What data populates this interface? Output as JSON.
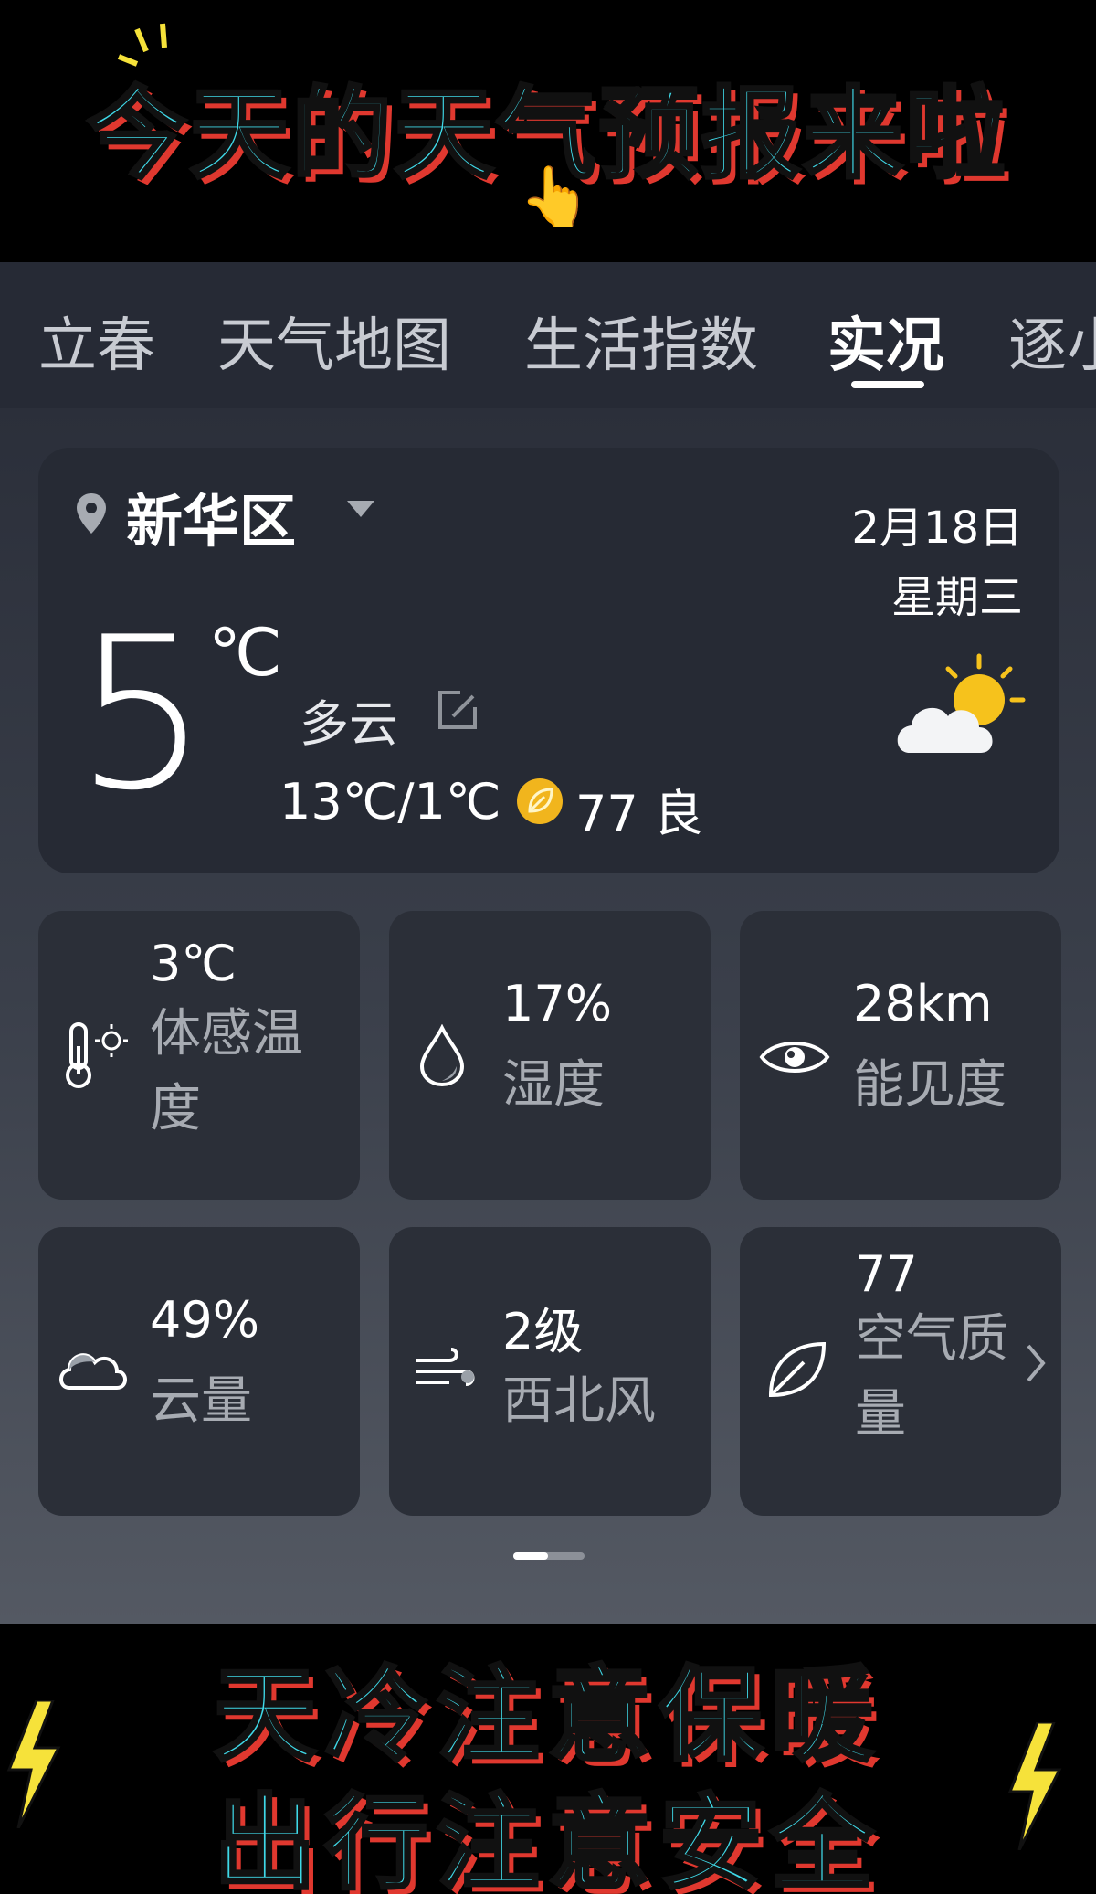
{
  "banner": {
    "title": "今天的天气预报来啦"
  },
  "tabs": [
    "立春",
    "天气地图",
    "生活指数",
    "实况",
    "逐小"
  ],
  "active_tab": "实况",
  "current": {
    "location": "新华区",
    "date": "2月18日",
    "weekday": "星期三",
    "temperature": "5",
    "unit": "℃",
    "condition": "多云",
    "range": "13℃/1℃",
    "aqi": "77 良"
  },
  "tiles": [
    {
      "value": "3℃",
      "label": "体感温度",
      "icon": "thermometer-sun-icon"
    },
    {
      "value": "17%",
      "label": "湿度",
      "icon": "water-drop-icon"
    },
    {
      "value": "28km",
      "label": "能见度",
      "icon": "eye-icon"
    },
    {
      "value": "49%",
      "label": "云量",
      "icon": "cloud-icon"
    },
    {
      "value": "2级",
      "label": "西北风",
      "icon": "wind-icon"
    },
    {
      "value": "77",
      "label": "空气质量",
      "icon": "leaf-icon"
    }
  ],
  "slogan": {
    "line1": "天冷注意保暖",
    "line2": "出行注意安全"
  },
  "colors": {
    "cyan_text": "#3fd9e8",
    "yellow_text": "#f6e23a",
    "outline_red": "#e0382f",
    "aqi_badge": "#f1b51d"
  }
}
